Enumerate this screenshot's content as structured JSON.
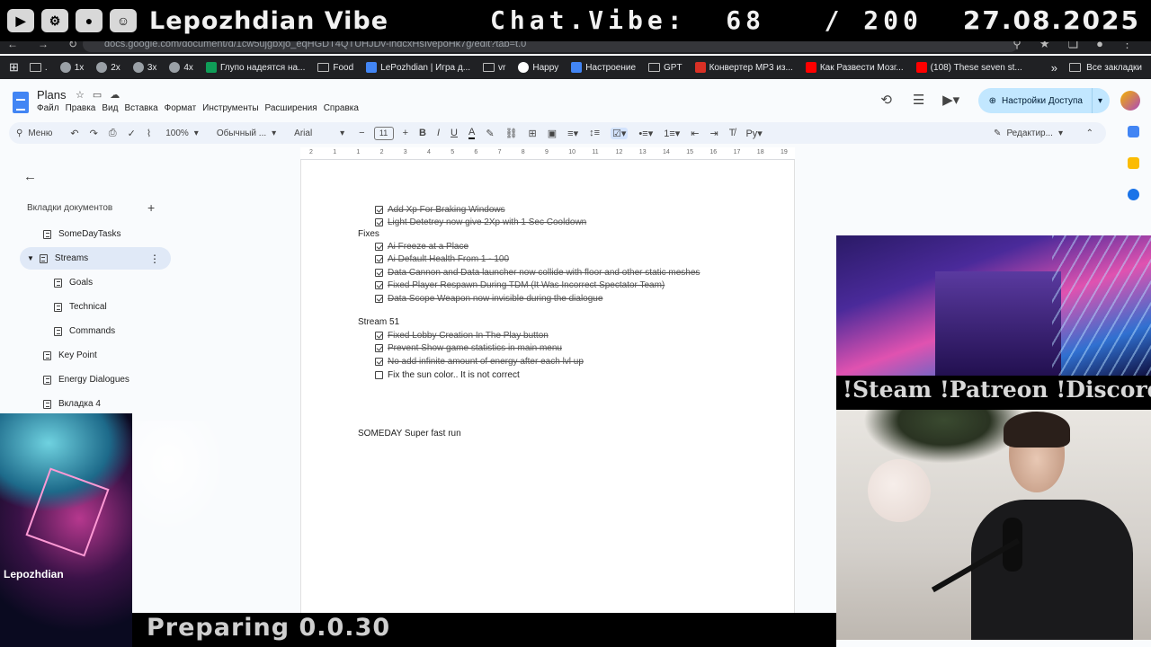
{
  "overlay": {
    "channel": "Lepozhdian Vibe",
    "chat": "Chat.Vibe:  68   / 200",
    "date": "27.08.2025",
    "social": "!Steam !Patreon !Discord",
    "preparing": "Preparing 0.0.30",
    "scene_tag": "Lepozhdian"
  },
  "browser": {
    "url": "docs.google.com/document/d/1cw5ujgbxjo_eqHGDT4QTUHJDv-lhdcxHsIvepoHk7g/edit?tab=t.0",
    "bookmarks_grid_label": "",
    "bookmarks": [
      {
        "label": ".",
        "type": "folder"
      },
      {
        "label": "1x",
        "type": "site"
      },
      {
        "label": "2x",
        "type": "site"
      },
      {
        "label": "3x",
        "type": "site"
      },
      {
        "label": "4x",
        "type": "site"
      },
      {
        "label": "Глупо надеятся на...",
        "type": "sheets"
      },
      {
        "label": "Food",
        "type": "folder"
      },
      {
        "label": "LePozhdian | Игра д...",
        "type": "doc"
      },
      {
        "label": "vr",
        "type": "folder"
      },
      {
        "label": "Happy",
        "type": "google"
      },
      {
        "label": "Настроение",
        "type": "docs"
      },
      {
        "label": "GPT",
        "type": "folder"
      },
      {
        "label": "Конвертер MP3 из...",
        "type": "red"
      },
      {
        "label": "Как Развести Мозг...",
        "type": "youtube"
      },
      {
        "label": "(108) These seven st...",
        "type": "youtube"
      }
    ],
    "all_bookmarks": "Все закладки"
  },
  "docs": {
    "title": "Plans",
    "menu": [
      "Файл",
      "Правка",
      "Вид",
      "Вставка",
      "Формат",
      "Инструменты",
      "Расширения",
      "Справка"
    ],
    "share_label": "Настройки Доступа",
    "toolbar": {
      "search": "Меню",
      "zoom": "100%",
      "style": "Обычный ...",
      "font": "Arial",
      "size": "11",
      "edit_mode": "Редактир..."
    },
    "ruler": [
      "2",
      "1",
      "1",
      "2",
      "3",
      "4",
      "5",
      "6",
      "7",
      "8",
      "9",
      "10",
      "11",
      "12",
      "13",
      "14",
      "15",
      "16",
      "17",
      "18",
      "19"
    ],
    "tabs_heading": "Вкладки документов",
    "tabs": [
      {
        "label": "SomeDayTasks",
        "level": 0
      },
      {
        "label": "Streams",
        "level": 0,
        "active": true
      },
      {
        "label": "Goals",
        "level": 1
      },
      {
        "label": "Technical",
        "level": 1
      },
      {
        "label": "Commands",
        "level": 1
      },
      {
        "label": "Key Point",
        "level": 0
      },
      {
        "label": "Energy Dialogues",
        "level": 0
      },
      {
        "label": "Вкладка 4",
        "level": 0
      }
    ],
    "content": [
      {
        "kind": "check",
        "checked": true,
        "text": "Add Xp For Braking Windows"
      },
      {
        "kind": "check",
        "checked": true,
        "text": "Light Detetrey now give 2Xp with 1 Sec Cooldown"
      },
      {
        "kind": "heading",
        "text": "Fixes"
      },
      {
        "kind": "check",
        "checked": true,
        "text": "Ai Freeze at a Place"
      },
      {
        "kind": "check",
        "checked": true,
        "text": "Ai Default Health From 1 - 100"
      },
      {
        "kind": "check",
        "checked": true,
        "text": "Data Cannon and Data launcher now collide with floor and other static meshes"
      },
      {
        "kind": "check",
        "checked": true,
        "text": "Fixed Player Respawn During TDM (It Was Incorrect Spectator Team)"
      },
      {
        "kind": "check",
        "checked": true,
        "text": "Data Scope Weapon now invisible during the dialogue"
      },
      {
        "kind": "heading",
        "text": "Stream 51"
      },
      {
        "kind": "check",
        "checked": true,
        "text": "Fixed Lobby Creation In The Play button"
      },
      {
        "kind": "check",
        "checked": true,
        "text": "Prevent Show game statistics in main menu"
      },
      {
        "kind": "check",
        "checked": true,
        "text": "No add infinite amount of energy after each lvl up"
      },
      {
        "kind": "check",
        "checked": false,
        "text": "Fix the sun color.. It is not correct"
      },
      {
        "kind": "heading",
        "text": "SOMEDAY Super fast run"
      }
    ]
  }
}
